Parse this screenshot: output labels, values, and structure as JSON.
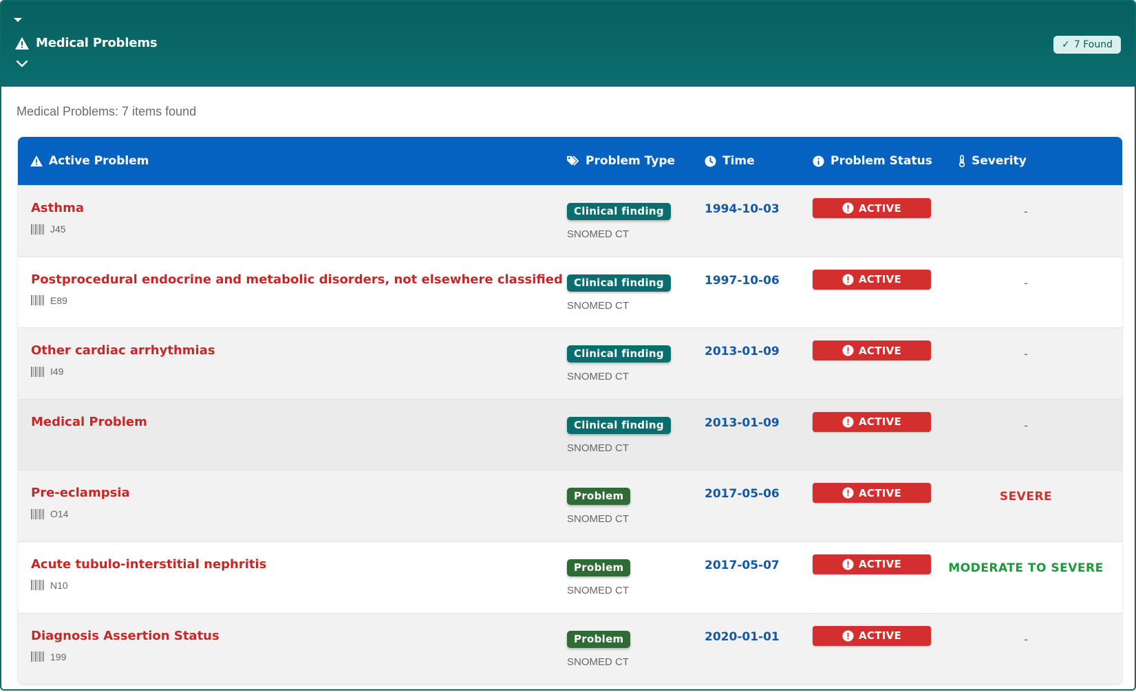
{
  "header": {
    "title": "Medical Problems",
    "found_badge": "7 Found",
    "found_check": "✓"
  },
  "summary": "Medical Problems: 7 items found",
  "table": {
    "columns": {
      "problem": "Active Problem",
      "type": "Problem Type",
      "time": "Time",
      "status": "Problem Status",
      "severity": "Severity"
    },
    "rows": [
      {
        "name": "Asthma",
        "code": "J45",
        "type": "Clinical finding",
        "type_kind": "clinical",
        "system": "SNOMED CT",
        "time": "1994-10-03",
        "status": "ACTIVE",
        "severity": "-",
        "severity_kind": "none"
      },
      {
        "name": "Postprocedural endocrine and metabolic disorders, not elsewhere classified",
        "code": "E89",
        "type": "Clinical finding",
        "type_kind": "clinical",
        "system": "SNOMED CT",
        "time": "1997-10-06",
        "status": "ACTIVE",
        "severity": "-",
        "severity_kind": "none"
      },
      {
        "name": "Other cardiac arrhythmias",
        "code": "I49",
        "type": "Clinical finding",
        "type_kind": "clinical",
        "system": "SNOMED CT",
        "time": "2013-01-09",
        "status": "ACTIVE",
        "severity": "-",
        "severity_kind": "none"
      },
      {
        "name": "Medical Problem",
        "code": "",
        "type": "Clinical finding",
        "type_kind": "clinical",
        "system": "SNOMED CT",
        "time": "2013-01-09",
        "status": "ACTIVE",
        "severity": "-",
        "severity_kind": "none"
      },
      {
        "name": "Pre-eclampsia",
        "code": "O14",
        "type": "Problem",
        "type_kind": "problem",
        "system": "SNOMED CT",
        "time": "2017-05-06",
        "status": "ACTIVE",
        "severity": "SEVERE",
        "severity_kind": "severe"
      },
      {
        "name": "Acute tubulo-interstitial nephritis",
        "code": "N10",
        "type": "Problem",
        "type_kind": "problem",
        "system": "SNOMED CT",
        "time": "2017-05-07",
        "status": "ACTIVE",
        "severity": "MODERATE TO SEVERE",
        "severity_kind": "moderate"
      },
      {
        "name": "Diagnosis Assertion Status",
        "code": "199",
        "type": "Problem",
        "type_kind": "problem",
        "system": "SNOMED CT",
        "time": "2020-01-01",
        "status": "ACTIVE",
        "severity": "-",
        "severity_kind": "none"
      }
    ]
  },
  "colors": {
    "header_bg": "#0b6e6e",
    "table_header_bg": "#0562c0",
    "problem_name": "#c62828",
    "time": "#1159a8",
    "status_active": "#d32f2f",
    "severity_severe": "#d32f2f",
    "severity_moderate": "#1a9a3a",
    "badge_clinical": "#0b6e6e",
    "badge_problem": "#2f6b34"
  },
  "icons": {
    "header": "warning-triangle-icon",
    "col_problem": "warning-triangle-icon",
    "col_type": "tags-icon",
    "col_time": "clock-icon",
    "col_status": "info-circle-icon",
    "col_severity": "thermometer-icon",
    "code": "barcode-icon",
    "status": "exclamation-circle-icon"
  }
}
